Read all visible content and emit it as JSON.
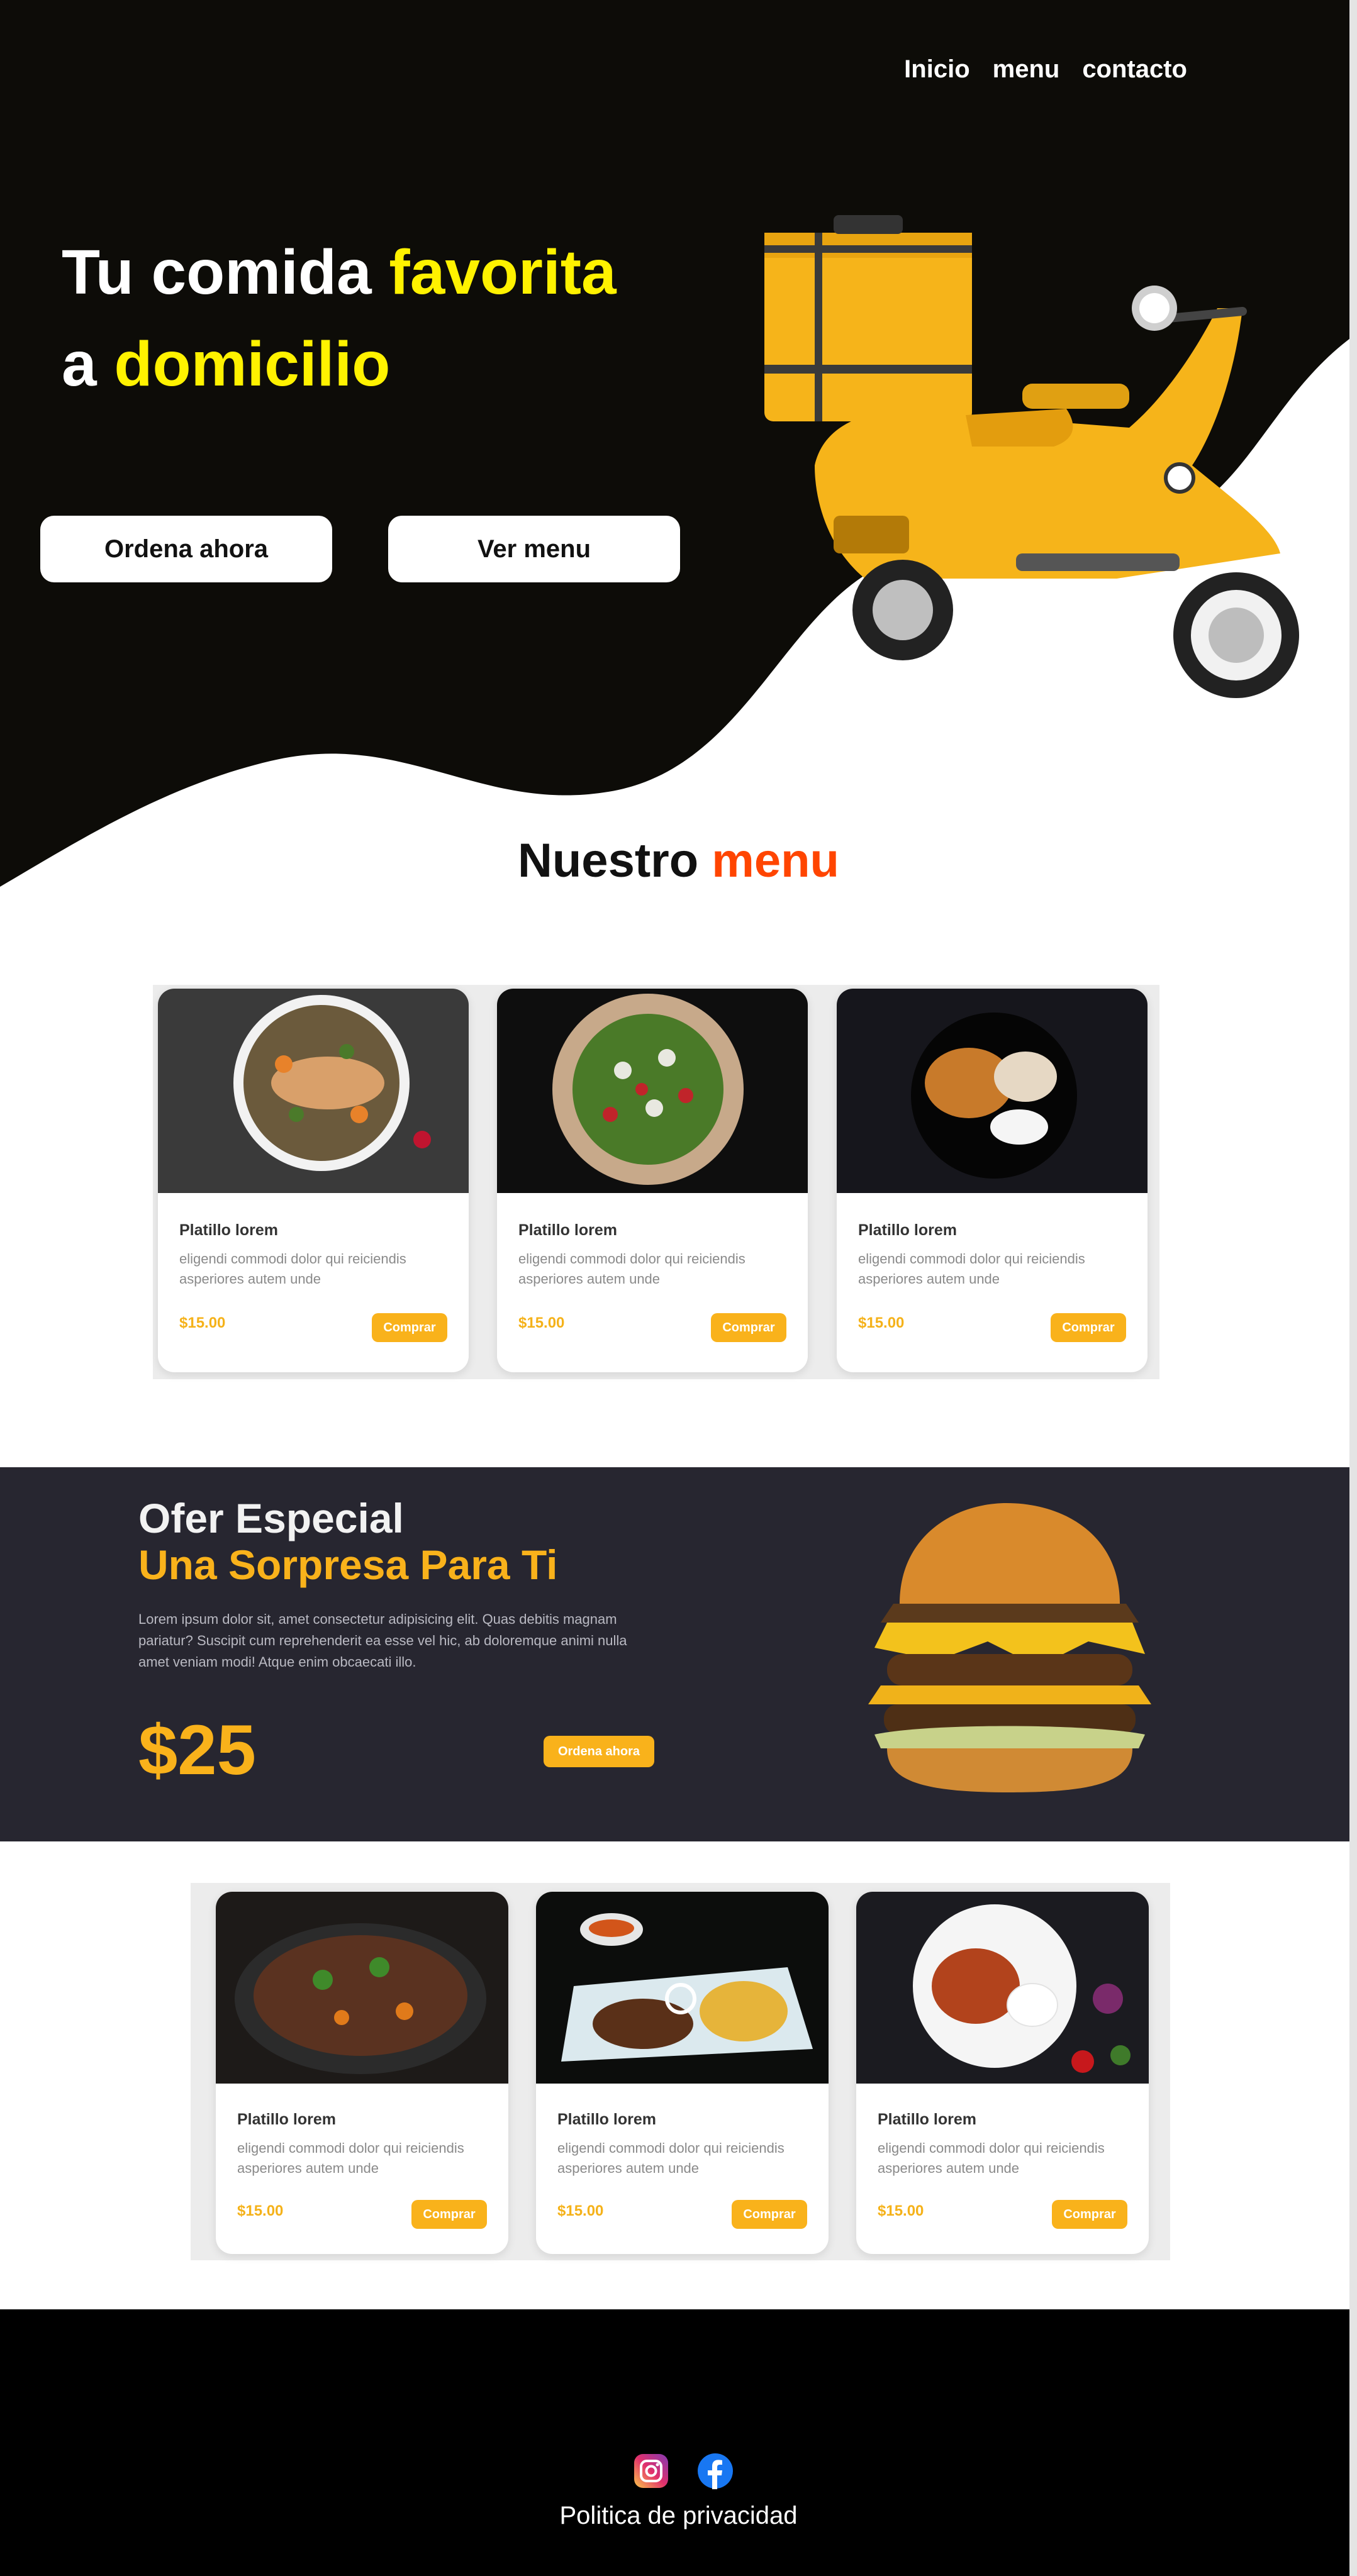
{
  "nav": {
    "items": [
      "Inicio",
      "menu",
      "contacto"
    ]
  },
  "hero": {
    "title_line1_white": "Tu comida ",
    "title_line1_accent": "favorita",
    "title_line2_white": "a ",
    "title_line2_accent": "domicilio",
    "button_order": "Ordena ahora",
    "button_menu": "Ver menu"
  },
  "menu_heading": {
    "text": "Nuestro ",
    "accent": "menu"
  },
  "menu_cards": [
    {
      "title": "Platillo lorem",
      "desc": "eligendi commodi dolor qui reiciendis asperiores autem unde",
      "price": "$15.00",
      "button": "Comprar"
    },
    {
      "title": "Platillo lorem",
      "desc": "eligendi commodi dolor qui reiciendis asperiores autem unde",
      "price": "$15.00",
      "button": "Comprar"
    },
    {
      "title": "Platillo lorem",
      "desc": "eligendi commodi dolor qui reiciendis asperiores autem unde",
      "price": "$15.00",
      "button": "Comprar"
    }
  ],
  "offer": {
    "title1": "Ofer Especial",
    "title2": "Una Sorpresa Para Ti",
    "body": "Lorem ipsum dolor sit, amet consectetur adipisicing elit. Quas debitis magnam pariatur? Suscipit cum reprehenderit ea esse vel hic, ab doloremque animi nulla amet veniam modi! Atque enim obcaecati illo.",
    "price": "$25",
    "button": "Ordena ahora"
  },
  "second_cards": [
    {
      "title": "Platillo lorem",
      "desc": "eligendi commodi dolor qui reiciendis asperiores autem unde",
      "price": "$15.00",
      "button": "Comprar"
    },
    {
      "title": "Platillo lorem",
      "desc": "eligendi commodi dolor qui reiciendis asperiores autem unde",
      "price": "$15.00",
      "button": "Comprar"
    },
    {
      "title": "Platillo lorem",
      "desc": "eligendi commodi dolor qui reiciendis asperiores autem unde",
      "price": "$15.00",
      "button": "Comprar"
    }
  ],
  "footer": {
    "privacy": "Politica de privacidad",
    "social_icons": [
      "instagram-icon",
      "facebook-icon"
    ]
  },
  "colors": {
    "hero_bg": "#0d0c08",
    "accent_yellow": "#fff200",
    "accent_orange": "#ff4500",
    "button_yellow": "#f9b21b",
    "offer_bg": "#272630",
    "footer_bg": "#000000"
  }
}
